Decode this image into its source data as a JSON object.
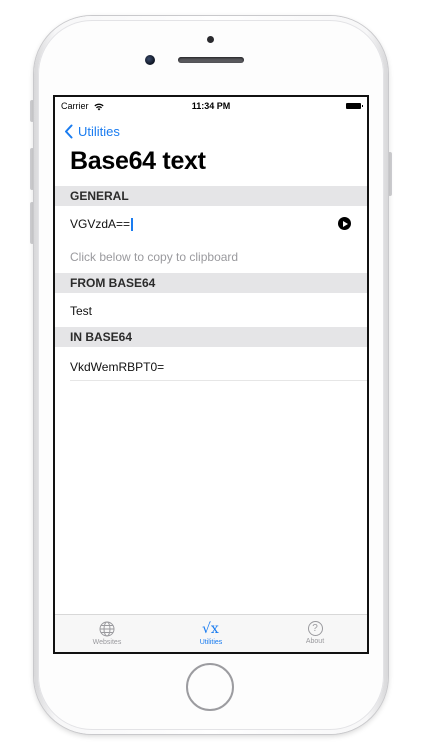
{
  "status_bar": {
    "carrier": "Carrier",
    "time": "11:34 PM"
  },
  "nav": {
    "back_label": "Utilities"
  },
  "page": {
    "title": "Base64 text"
  },
  "sections": {
    "general": "GENERAL",
    "from_base64": "FROM BASE64",
    "in_base64": "IN BASE64"
  },
  "general": {
    "input_value": "VGVzdA==",
    "hint": "Click below to copy to clipboard"
  },
  "from_base64": {
    "value": "Test"
  },
  "in_base64": {
    "value": "VkdWemRBPT0="
  },
  "tab_bar": {
    "items": [
      {
        "label": "Websites",
        "icon": "globe-icon"
      },
      {
        "label": "Utilities",
        "icon": "sqrt-icon",
        "glyph": "√x"
      },
      {
        "label": "About",
        "icon": "question-circle-icon",
        "glyph": "?"
      }
    ],
    "active_index": 1
  },
  "colors": {
    "accent": "#1a7cf0",
    "section_bg": "#e5e5e7",
    "hint": "#9a9a9e"
  }
}
